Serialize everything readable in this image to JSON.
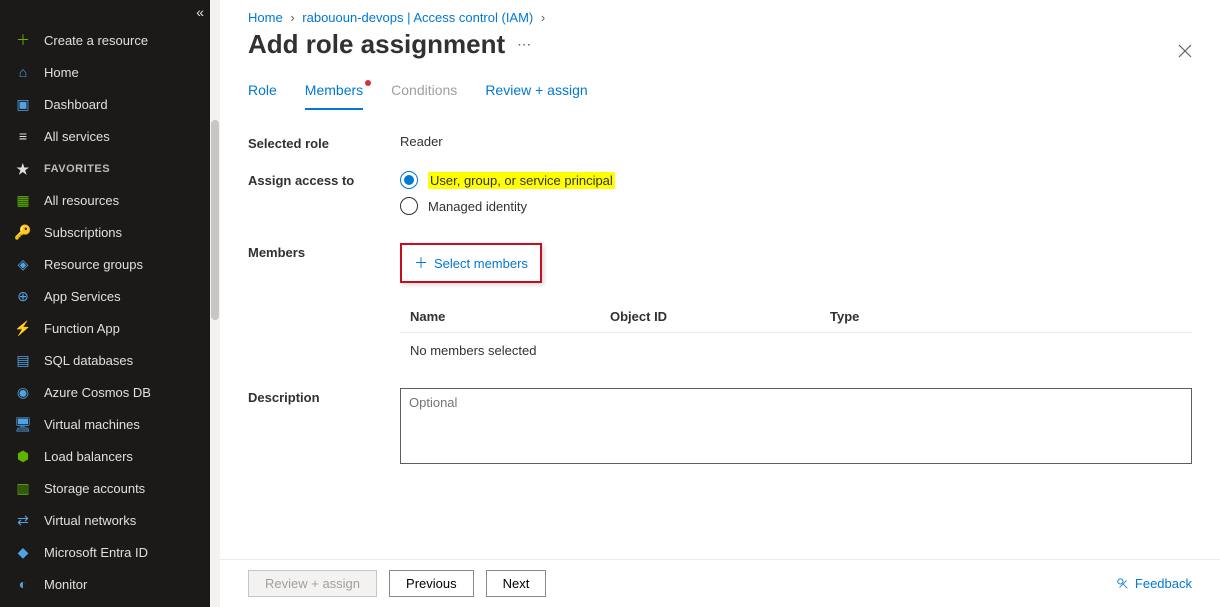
{
  "sidebar": {
    "collapse_glyph": "«",
    "items_top": [
      {
        "icon": "＋",
        "label": "Create a resource",
        "color": "#5db300"
      },
      {
        "icon": "⌂",
        "label": "Home",
        "color": "#4fa3e3"
      },
      {
        "icon": "▣",
        "label": "Dashboard",
        "color": "#4fa3e3"
      },
      {
        "icon": "≡",
        "label": "All services",
        "color": "#e1dfdd"
      }
    ],
    "fav_header": "FAVORITES",
    "items_fav": [
      {
        "icon": "▦",
        "label": "All resources",
        "color": "#5db300"
      },
      {
        "icon": "🔑",
        "label": "Subscriptions",
        "color": "#ffb900"
      },
      {
        "icon": "◈",
        "label": "Resource groups",
        "color": "#4fa3e3"
      },
      {
        "icon": "⊕",
        "label": "App Services",
        "color": "#4fa3e3"
      },
      {
        "icon": "⚡",
        "label": "Function App",
        "color": "#ffb900"
      },
      {
        "icon": "▤",
        "label": "SQL databases",
        "color": "#4fa3e3"
      },
      {
        "icon": "◉",
        "label": "Azure Cosmos DB",
        "color": "#4fa3e3"
      },
      {
        "icon": "🖥",
        "label": "Virtual machines",
        "color": "#4fa3e3"
      },
      {
        "icon": "⬢",
        "label": "Load balancers",
        "color": "#5db300"
      },
      {
        "icon": "▥",
        "label": "Storage accounts",
        "color": "#5db300"
      },
      {
        "icon": "⇄",
        "label": "Virtual networks",
        "color": "#4fa3e3"
      },
      {
        "icon": "◆",
        "label": "Microsoft Entra ID",
        "color": "#4fa3e3"
      },
      {
        "icon": "◐",
        "label": "Monitor",
        "color": "#4fa3e3"
      }
    ]
  },
  "breadcrumb": {
    "items": [
      "Home",
      "rabououn-devops | Access control (IAM)"
    ],
    "sep": "›"
  },
  "page": {
    "title": "Add role assignment",
    "ellipsis": "⋯"
  },
  "tabs": [
    {
      "label": "Role",
      "active": false,
      "link": true
    },
    {
      "label": "Members",
      "active": true,
      "link": true,
      "dot": true
    },
    {
      "label": "Conditions",
      "active": false,
      "link": false
    },
    {
      "label": "Review + assign",
      "active": false,
      "link": true
    }
  ],
  "form": {
    "selected_role_label": "Selected role",
    "selected_role_value": "Reader",
    "assign_label": "Assign access to",
    "radio_user": "User, group, or service principal",
    "radio_managed": "Managed identity",
    "members_label": "Members",
    "select_members": "Select members",
    "table": {
      "col_name": "Name",
      "col_obj": "Object ID",
      "col_type": "Type",
      "empty": "No members selected"
    },
    "description_label": "Description",
    "description_placeholder": "Optional"
  },
  "footer": {
    "review": "Review + assign",
    "prev": "Previous",
    "next": "Next",
    "feedback": "Feedback"
  }
}
